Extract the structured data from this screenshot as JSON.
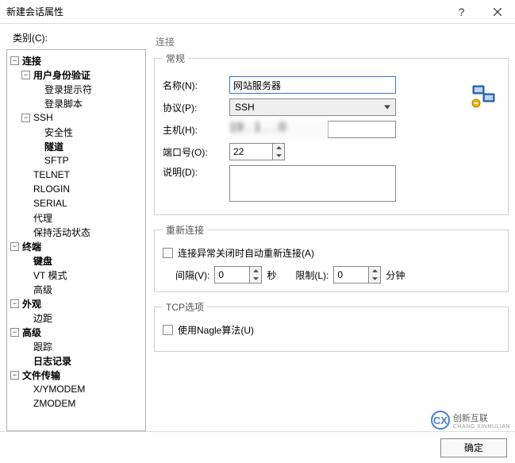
{
  "titlebar": {
    "title": "新建会话属性"
  },
  "category_label": "类别(C):",
  "tree": {
    "connection": "连接",
    "auth": "用户身份验证",
    "login_prompt": "登录提示符",
    "login_script": "登录脚本",
    "ssh": "SSH",
    "security": "安全性",
    "tunnel": "隧道",
    "sftp": "SFTP",
    "telnet": "TELNET",
    "rlogin": "RLOGIN",
    "serial": "SERIAL",
    "proxy": "代理",
    "keep_alive": "保持活动状态",
    "terminal": "终端",
    "keyboard": "键盘",
    "vt_mode": "VT 模式",
    "advanced": "高级",
    "appearance": "外观",
    "margin": "边距",
    "advanced2": "高级",
    "tracking": "跟踪",
    "log": "日志记录",
    "file_transfer": "文件传输",
    "xymodem": "X/YMODEM",
    "zmodem": "ZMODEM"
  },
  "panel": {
    "heading": "连接",
    "groups": {
      "general": "常规",
      "reconnect": "重新连接",
      "tcp": "TCP选项"
    },
    "labels": {
      "name": "名称(N):",
      "protocol": "协议(P):",
      "host": "主机(H):",
      "port": "端口号(O):",
      "description": "说明(D):",
      "interval": "间隔(V):",
      "limit": "限制(L):",
      "seconds": "秒",
      "minutes": "分钟"
    },
    "values": {
      "name": "网站服务器",
      "protocol": "SSH",
      "host": "",
      "port": "22",
      "description": "",
      "interval": "0",
      "limit": "0"
    },
    "checkboxes": {
      "auto_reconnect": "连接异常关闭时自动重新连接(A)",
      "nagle": "使用Nagle算法(U)"
    }
  },
  "buttons": {
    "ok": "确定"
  },
  "watermark": {
    "text": "创新互联",
    "sub": "CHANG XINHULIAN"
  }
}
